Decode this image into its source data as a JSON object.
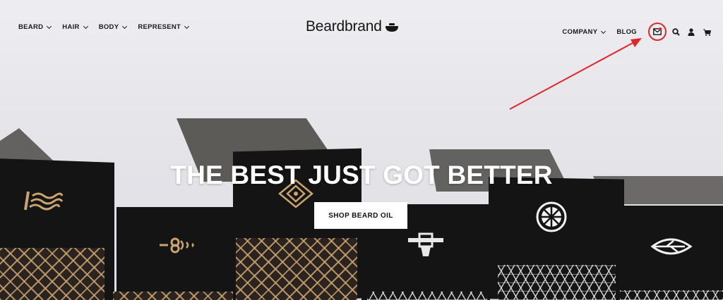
{
  "brand": {
    "name": "Beardbrand"
  },
  "nav": {
    "left": [
      {
        "label": "BEARD"
      },
      {
        "label": "HAIR"
      },
      {
        "label": "BODY"
      },
      {
        "label": "REPRESENT"
      }
    ],
    "right": [
      {
        "label": "COMPANY",
        "has_dropdown": true
      },
      {
        "label": "BLOG",
        "has_dropdown": false
      }
    ],
    "icons": [
      "mail-icon",
      "search-icon",
      "account-icon",
      "cart-icon"
    ]
  },
  "hero": {
    "headline": "THE BEST JUST GOT BETTER",
    "cta_label": "SHOP BEARD OIL"
  },
  "annotation": {
    "color": "#e0282a",
    "target": "mail-icon"
  },
  "colors": {
    "text": "#1b1b1b",
    "accent": "#e0282a",
    "box_black": "#141414",
    "gold": "#c9a46e"
  }
}
